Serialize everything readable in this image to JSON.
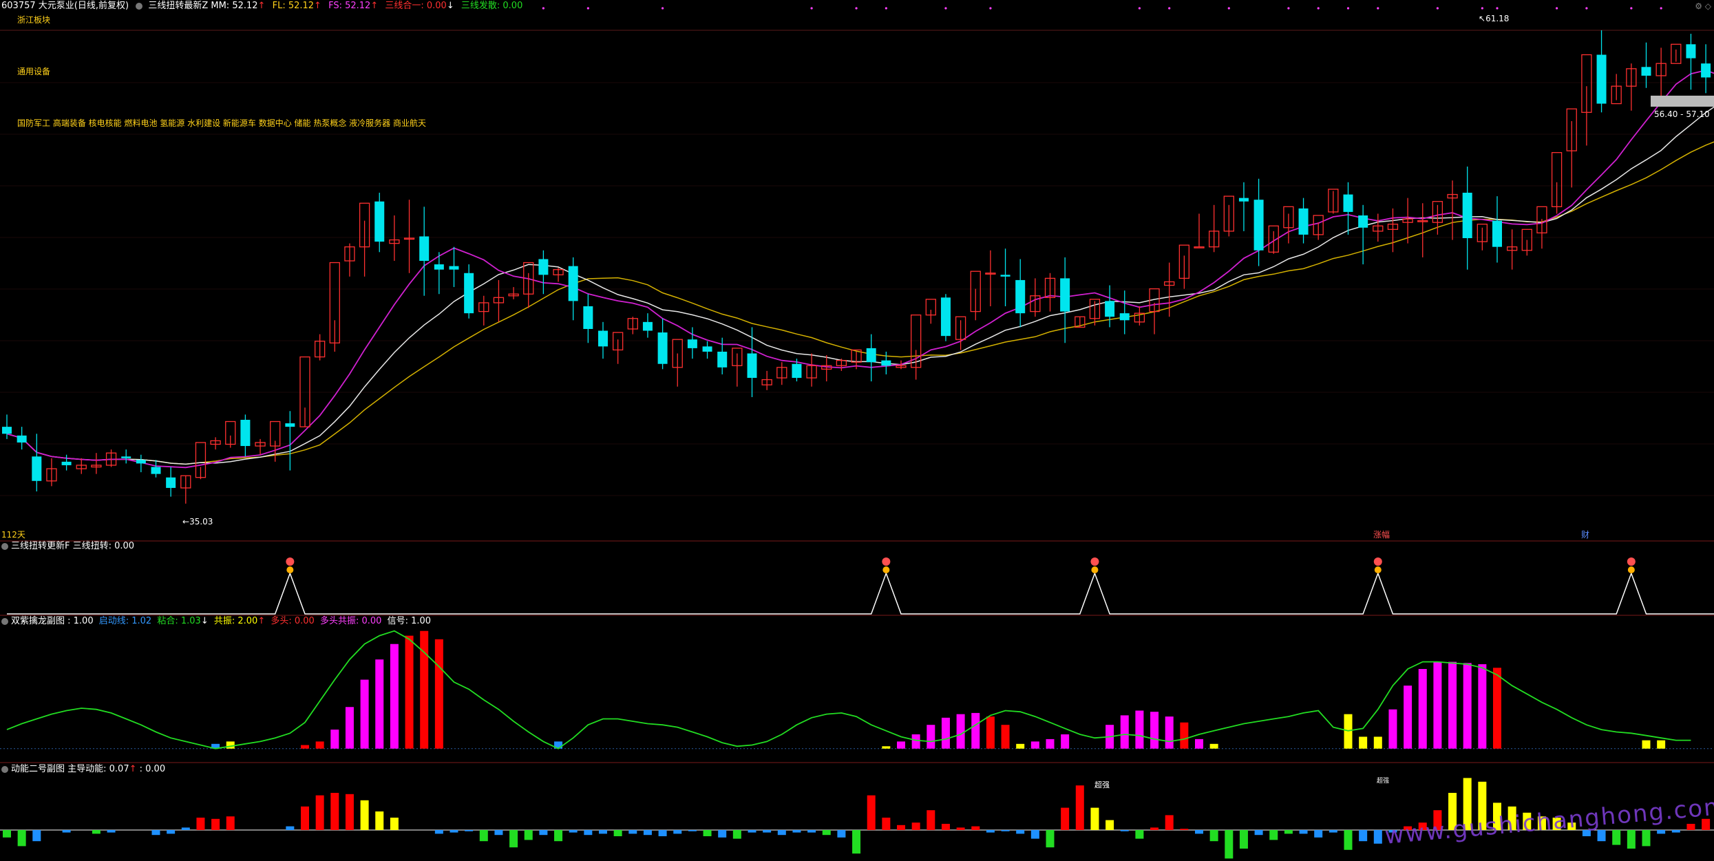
{
  "header": {
    "code_name": "603757 大元泵业(日线,前复权)",
    "indicator": "三线扭转最新Z",
    "mm": "MM: 52.12",
    "fl": "FL: 52.12",
    "fs": "FS: 52.12",
    "sanxian_heyi": "三线合一: 0.00",
    "sanxian_fasan": "三线发散: 0.00"
  },
  "boards": {
    "region": "浙江板块",
    "industry": "通用设备",
    "concepts": "国防军工 高端装备 核电核能 燃料电池 氢能源 水利建设 新能源车 数据中心 储能 热泵概念 液冷服务器 商业航天"
  },
  "annotations": {
    "high_label": "61.18",
    "low_label": "35.03",
    "price_tag": "56.40 - 57.10",
    "days_label": "112天",
    "event_1": "涨幅",
    "event_2": "财"
  },
  "panels": {
    "p1_title": "三线扭转更新F  三线扭转: 0.00",
    "p2_title": "双紫擒龙副图 : 1.00",
    "p2_qidong": "启动线: 1.02",
    "p2_nianhe": "粘合: 1.03",
    "p2_gongzhen": "共振: 2.00",
    "p2_duotou": "多头: 0.00",
    "p2_duotou_gz": "多头共振: 0.00",
    "p2_xinhao": "信号: 1.00",
    "p3_title": "动能二号副图  主导动能: 0.07",
    "p3_extra": ": 0.00",
    "p3_strong": "超强",
    "p3_strong2": "超强"
  },
  "watermark": "www.gushichanghong.com",
  "colors": {
    "up": "#ff3030",
    "down": "#00e5ee",
    "ma_yellow": "#d4b100",
    "ma_white": "#e8e8e8",
    "ma_magenta": "#d020d0",
    "bar_magenta": "#ff00ff",
    "bar_red": "#ff0000",
    "bar_yellow": "#ffff00",
    "bar_blue": "#1e90ff",
    "line_green": "#22dd22",
    "signal_white": "#ffffff",
    "board_text": "#ffd11a",
    "separator": "#7a1a1a"
  },
  "chart_data": [
    {
      "type": "candlestick",
      "ylim": [
        34,
        63
      ],
      "candles": [
        [
          40.3,
          41.0,
          39.9,
          39.6
        ],
        [
          39.8,
          40.3,
          39.4,
          39.0
        ],
        [
          38.6,
          39.9,
          37.2,
          36.6
        ],
        [
          37.2,
          38.5,
          37.9,
          36.9
        ],
        [
          38.3,
          38.7,
          38.1,
          37.8
        ],
        [
          37.9,
          38.5,
          38.1,
          37.6
        ],
        [
          38.0,
          38.8,
          38.1,
          37.6
        ],
        [
          38.1,
          39.0,
          38.8,
          38.0
        ],
        [
          38.6,
          39.0,
          38.5,
          38.2
        ],
        [
          38.4,
          38.7,
          38.2,
          37.7
        ],
        [
          38.0,
          38.4,
          37.6,
          37.4
        ],
        [
          37.4,
          38.0,
          36.8,
          36.3
        ],
        [
          36.8,
          37.5,
          37.5,
          35.9
        ],
        [
          37.4,
          38.0,
          39.4,
          37.3
        ],
        [
          39.3,
          39.7,
          39.5,
          39.0
        ],
        [
          39.3,
          39.8,
          40.6,
          39.1
        ],
        [
          40.7,
          41.0,
          39.2,
          38.6
        ],
        [
          39.2,
          39.6,
          39.4,
          38.7
        ],
        [
          39.2,
          39.5,
          40.6,
          38.3
        ],
        [
          40.5,
          41.2,
          40.3,
          37.8
        ],
        [
          40.3,
          41.4,
          44.3,
          40.3
        ],
        [
          44.3,
          45.6,
          45.2,
          44.1
        ],
        [
          45.1,
          46.4,
          49.7,
          44.6
        ],
        [
          49.8,
          50.8,
          50.6,
          48.9
        ],
        [
          50.6,
          52.1,
          53.1,
          48.9
        ],
        [
          53.2,
          53.7,
          50.9,
          50.3
        ],
        [
          50.8,
          52.4,
          51.0,
          49.8
        ],
        [
          51.1,
          53.3,
          51.1,
          49.1
        ],
        [
          51.2,
          52.9,
          49.8,
          47.8
        ],
        [
          49.6,
          50.3,
          49.3,
          47.9
        ],
        [
          49.5,
          50.6,
          49.3,
          48.3
        ],
        [
          49.1,
          49.6,
          46.8,
          46.5
        ],
        [
          46.9,
          47.8,
          47.4,
          46.1
        ],
        [
          47.4,
          48.7,
          47.7,
          46.3
        ],
        [
          47.8,
          48.3,
          47.9,
          47.6
        ],
        [
          47.9,
          49.1,
          49.7,
          47.1
        ],
        [
          49.9,
          50.4,
          49.0,
          47.9
        ],
        [
          49.0,
          49.4,
          49.3,
          48.6
        ],
        [
          49.5,
          50.0,
          47.5,
          46.4
        ],
        [
          47.2,
          47.9,
          45.9,
          45.1
        ],
        [
          45.8,
          46.3,
          44.9,
          44.2
        ],
        [
          44.7,
          45.3,
          45.7,
          43.9
        ],
        [
          45.9,
          46.6,
          46.5,
          45.6
        ],
        [
          46.3,
          46.8,
          45.8,
          45.4
        ],
        [
          45.7,
          46.5,
          43.9,
          43.6
        ],
        [
          43.7,
          44.5,
          45.3,
          42.6
        ],
        [
          45.3,
          46.0,
          44.8,
          44.2
        ],
        [
          44.9,
          45.2,
          44.6,
          44.2
        ],
        [
          44.6,
          45.4,
          43.7,
          43.3
        ],
        [
          43.8,
          44.5,
          44.8,
          42.6
        ],
        [
          44.5,
          46.0,
          43.1,
          42.0
        ],
        [
          42.7,
          43.5,
          43.0,
          42.4
        ],
        [
          43.1,
          44.0,
          43.7,
          42.7
        ],
        [
          43.9,
          44.2,
          43.1,
          42.9
        ],
        [
          43.1,
          44.5,
          43.8,
          42.6
        ],
        [
          43.6,
          44.4,
          43.8,
          42.9
        ],
        [
          43.8,
          44.2,
          44.1,
          43.5
        ],
        [
          44.0,
          44.6,
          44.7,
          43.6
        ],
        [
          44.8,
          45.6,
          44.0,
          42.9
        ],
        [
          44.1,
          44.6,
          43.8,
          43.3
        ],
        [
          43.7,
          44.1,
          43.8,
          43.6
        ],
        [
          43.7,
          44.7,
          46.7,
          43.0
        ],
        [
          46.7,
          47.0,
          47.6,
          46.2
        ],
        [
          47.7,
          47.9,
          45.5,
          45.2
        ],
        [
          45.3,
          46.4,
          46.6,
          44.7
        ],
        [
          46.9,
          48.2,
          49.2,
          46.4
        ],
        [
          49.1,
          50.4,
          49.1,
          47.2
        ],
        [
          49.0,
          50.5,
          48.9,
          47.2
        ],
        [
          48.7,
          49.9,
          46.8,
          46.0
        ],
        [
          46.9,
          48.8,
          47.8,
          46.6
        ],
        [
          47.7,
          49.1,
          48.8,
          46.9
        ],
        [
          48.8,
          50.0,
          46.9,
          45.1
        ],
        [
          46.0,
          46.6,
          46.6,
          46.0
        ],
        [
          46.5,
          47.5,
          47.6,
          46.1
        ],
        [
          47.5,
          48.4,
          46.6,
          46.0
        ],
        [
          46.8,
          48.1,
          46.4,
          45.6
        ],
        [
          46.3,
          47.2,
          46.8,
          46.1
        ],
        [
          46.9,
          47.4,
          48.2,
          45.6
        ],
        [
          48.4,
          49.7,
          48.6,
          46.6
        ],
        [
          48.8,
          50.1,
          50.7,
          48.2
        ],
        [
          50.6,
          52.5,
          50.6,
          50.6
        ],
        [
          50.6,
          53.0,
          51.5,
          50.3
        ],
        [
          51.5,
          53.0,
          53.5,
          51.2
        ],
        [
          53.4,
          54.3,
          53.2,
          51.5
        ],
        [
          53.3,
          54.5,
          50.4,
          49.5
        ],
        [
          50.3,
          51.5,
          51.8,
          50.2
        ],
        [
          51.7,
          52.5,
          52.9,
          50.8
        ],
        [
          52.8,
          53.4,
          51.3,
          50.8
        ],
        [
          51.3,
          52.0,
          52.4,
          51.0
        ],
        [
          52.6,
          53.8,
          53.9,
          52.5
        ],
        [
          53.6,
          54.3,
          52.6,
          51.3
        ],
        [
          52.4,
          53.0,
          51.7,
          49.6
        ],
        [
          51.5,
          52.5,
          51.8,
          50.9
        ],
        [
          51.6,
          52.8,
          51.9,
          50.3
        ],
        [
          52.0,
          53.4,
          52.2,
          50.8
        ],
        [
          52.1,
          53.1,
          52.1,
          50.0
        ],
        [
          52.0,
          53.0,
          53.2,
          51.3
        ],
        [
          53.4,
          54.4,
          53.6,
          51.0
        ],
        [
          53.7,
          55.2,
          51.1,
          49.3
        ],
        [
          50.9,
          51.7,
          51.9,
          50.4
        ],
        [
          52.1,
          53.5,
          50.6,
          49.7
        ],
        [
          50.4,
          51.6,
          50.6,
          49.3
        ],
        [
          50.4,
          51.0,
          51.6,
          50.1
        ],
        [
          51.4,
          52.2,
          52.9,
          50.5
        ],
        [
          52.9,
          54.3,
          56.0,
          52.5
        ],
        [
          56.1,
          57.8,
          58.5,
          54.0
        ],
        [
          58.3,
          59.8,
          61.6,
          56.4
        ],
        [
          61.6,
          63.0,
          58.8,
          58.3
        ],
        [
          58.8,
          60.5,
          59.8,
          59.0
        ],
        [
          59.8,
          61.1,
          60.8,
          58.4
        ],
        [
          60.9,
          62.3,
          60.4,
          59.7
        ],
        [
          60.4,
          62.0,
          61.1,
          58.9
        ],
        [
          61.1,
          61.9,
          62.2,
          61.2
        ],
        [
          62.2,
          62.8,
          61.4,
          59.6
        ],
        [
          61.1,
          62.2,
          60.3,
          59.4
        ],
        [
          60.1,
          61.0,
          58.8,
          57.9
        ],
        [
          58.8,
          60.4,
          58.4,
          57.5
        ],
        [
          58.7,
          59.9,
          58.2,
          56.8
        ],
        [
          58.1,
          58.4,
          57.2,
          55.9
        ],
        [
          57.3,
          58.2,
          57.5,
          56.5
        ],
        [
          57.4,
          58.4,
          57.1,
          56.4
        ],
        [
          57.0,
          57.8,
          57.2,
          56.7
        ],
        [
          57.1,
          57.6,
          57.3,
          56.4
        ],
        [
          57.2,
          58.2,
          57.4,
          56.7
        ],
        [
          57.4,
          58.6,
          58.5,
          56.1
        ],
        [
          58.6,
          60.5,
          59.6,
          57.4
        ],
        [
          59.7,
          60.9,
          60.8,
          59.5
        ],
        [
          60.7,
          63.0,
          62.6,
          60.4
        ]
      ]
    },
    {
      "type": "line",
      "name": "三线扭转",
      "peaks_at": [
        19,
        59,
        73,
        92,
        109
      ],
      "ylim": [
        0,
        1
      ]
    },
    {
      "type": "bar",
      "title": "双紫擒龙副图",
      "ylim": [
        -1,
        10
      ],
      "line": [
        1.6,
        2.1,
        2.5,
        2.9,
        3.2,
        3.4,
        3.3,
        3.0,
        2.5,
        2.0,
        1.4,
        0.9,
        0.6,
        0.3,
        0.0,
        0.2,
        0.4,
        0.6,
        0.9,
        1.3,
        2.2,
        4.0,
        5.8,
        7.5,
        8.8,
        9.5,
        9.9,
        9.2,
        8.1,
        6.9,
        5.6,
        5.0,
        4.1,
        3.3,
        2.3,
        1.4,
        0.6,
        0.0,
        0.9,
        2.0,
        2.5,
        2.5,
        2.3,
        2.1,
        2.0,
        1.8,
        1.4,
        1.0,
        0.5,
        0.2,
        0.3,
        0.6,
        1.2,
        2.0,
        2.6,
        2.9,
        3.0,
        2.7,
        2.0,
        1.5,
        1.0,
        0.7,
        0.6,
        0.8,
        1.2,
        2.0,
        2.8,
        3.2,
        3.1,
        2.7,
        2.2,
        1.7,
        1.2,
        0.9,
        1.0,
        1.2,
        1.1,
        0.8,
        0.6,
        0.8,
        1.2,
        1.5,
        1.8,
        2.1,
        2.3,
        2.5,
        2.7,
        3.0,
        3.2,
        1.8,
        1.5,
        1.7,
        3.3,
        5.3,
        6.7,
        7.3,
        7.3,
        7.2,
        7.1,
        6.8,
        6.2,
        5.3,
        4.6,
        3.9,
        3.3,
        2.6,
        2.0,
        1.6,
        1.4,
        1.3,
        1.1,
        0.9,
        0.7,
        0.7
      ],
      "bars_index": [
        14,
        15,
        20,
        21,
        22,
        23,
        24,
        25,
        26,
        27,
        28,
        29,
        37,
        59,
        60,
        61,
        62,
        63,
        64,
        65,
        66,
        67,
        68,
        69,
        70,
        71,
        74,
        75,
        76,
        77,
        78,
        79,
        80,
        81,
        90,
        91,
        92,
        93,
        94,
        95,
        96,
        97,
        98,
        99,
        100,
        110,
        111
      ],
      "bars_value": [
        0.4,
        0.6,
        0.3,
        0.6,
        1.6,
        3.5,
        5.8,
        7.5,
        8.8,
        9.5,
        9.9,
        9.2,
        0.6,
        0.2,
        0.6,
        1.2,
        2.0,
        2.6,
        2.9,
        3.0,
        2.7,
        2.0,
        0.4,
        0.6,
        0.8,
        1.2,
        2.0,
        2.8,
        3.2,
        3.1,
        2.7,
        2.2,
        0.8,
        0.4,
        2.9,
        1.0,
        1.0,
        3.3,
        5.3,
        6.7,
        7.3,
        7.3,
        7.2,
        7.1,
        6.8,
        0.7,
        0.7
      ],
      "bars_color": [
        "blue",
        "yellow",
        "red",
        "red",
        "magenta",
        "magenta",
        "magenta",
        "magenta",
        "magenta",
        "red",
        "red",
        "red",
        "blue",
        "yellow",
        "magenta",
        "magenta",
        "magenta",
        "magenta",
        "magenta",
        "magenta",
        "red",
        "red",
        "yellow",
        "magenta",
        "magenta",
        "magenta",
        "magenta",
        "magenta",
        "magenta",
        "magenta",
        "magenta",
        "red",
        "magenta",
        "yellow",
        "yellow",
        "yellow",
        "yellow",
        "magenta",
        "magenta",
        "magenta",
        "magenta",
        "magenta",
        "magenta",
        "magenta",
        "red",
        "yellow",
        "yellow"
      ]
    },
    {
      "type": "bar",
      "title": "动能二号副图",
      "ylim": [
        -2.5,
        4.5
      ],
      "values": [
        -0.6,
        -1.3,
        -0.9,
        0.1,
        -0.2,
        0.0,
        -0.3,
        -0.2,
        0.1,
        0.1,
        -0.4,
        -0.3,
        0.2,
        1.0,
        0.9,
        1.1,
        0.1,
        0.2,
        0.0,
        0.3,
        1.9,
        2.8,
        3.0,
        2.9,
        2.4,
        1.5,
        1.0,
        0.3,
        0.1,
        -0.3,
        -0.2,
        -0.1,
        -0.9,
        -0.4,
        -1.4,
        -0.8,
        -0.4,
        -0.9,
        -0.2,
        -0.4,
        -0.3,
        -0.5,
        -0.3,
        -0.4,
        -0.5,
        -0.3,
        -0.1,
        -0.5,
        -0.6,
        -0.7,
        -0.2,
        -0.2,
        -0.4,
        -0.2,
        -0.2,
        -0.4,
        -0.6,
        -1.9,
        2.8,
        1.0,
        0.4,
        0.6,
        1.6,
        0.5,
        0.2,
        0.3,
        -0.2,
        -0.1,
        -0.3,
        -0.7,
        -1.4,
        1.8,
        3.6,
        1.8,
        0.8,
        -0.1,
        -0.7,
        0.2,
        1.2,
        0.1,
        -0.3,
        -0.9,
        -2.3,
        -1.5,
        -0.4,
        -0.8,
        -0.3,
        -0.3,
        -0.6,
        -0.2,
        -1.6,
        -0.9,
        -1.1,
        -0.2,
        0.3,
        0.6,
        1.6,
        3.0,
        4.2,
        3.9,
        2.2,
        1.9,
        1.4,
        1.1,
        1.0,
        0.6,
        -0.5,
        -0.9,
        -1.2,
        -1.5,
        -1.3,
        -0.3,
        -0.2,
        0.5,
        0.9,
        2.8
      ],
      "colors": [
        "green",
        "green",
        "blue",
        "",
        "blue",
        "",
        "green",
        "blue",
        "",
        "",
        "blue",
        "blue",
        "blue",
        "red",
        "red",
        "red",
        "",
        "",
        "",
        "blue",
        "red",
        "red",
        "red",
        "red",
        "yellow",
        "yellow",
        "yellow",
        "",
        "",
        "blue",
        "blue",
        "blue",
        "green",
        "blue",
        "green",
        "green",
        "blue",
        "green",
        "blue",
        "blue",
        "blue",
        "green",
        "blue",
        "blue",
        "blue",
        "blue",
        "blue",
        "green",
        "blue",
        "green",
        "blue",
        "blue",
        "blue",
        "blue",
        "blue",
        "green",
        "blue",
        "green",
        "red",
        "red",
        "red",
        "red",
        "red",
        "red",
        "red",
        "red",
        "blue",
        "blue",
        "blue",
        "blue",
        "green",
        "red",
        "red",
        "yellow",
        "yellow",
        "blue",
        "green",
        "red",
        "red",
        "red",
        "blue",
        "green",
        "green",
        "green",
        "blue",
        "green",
        "green",
        "blue",
        "blue",
        "blue",
        "green",
        "blue",
        "blue",
        "blue",
        "red",
        "red",
        "red",
        "yellow",
        "yellow",
        "yellow",
        "yellow",
        "yellow",
        "yellow",
        "yellow",
        "yellow",
        "yellow",
        "blue",
        "blue",
        "green",
        "green",
        "green",
        "blue",
        "blue",
        "red",
        "red",
        "red"
      ]
    }
  ]
}
